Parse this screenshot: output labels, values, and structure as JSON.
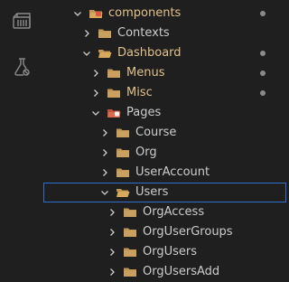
{
  "tree": [
    {
      "label": "components",
      "expanded": true,
      "modified": true,
      "folder": "special",
      "depth": 0
    },
    {
      "label": "Contexts",
      "expanded": false,
      "modified": false,
      "folder": "plain",
      "depth": 1
    },
    {
      "label": "Dashboard",
      "expanded": true,
      "modified": true,
      "folder": "plain",
      "depth": 1
    },
    {
      "label": "Menus",
      "expanded": false,
      "modified": true,
      "folder": "plain",
      "depth": 2
    },
    {
      "label": "Misc",
      "expanded": false,
      "modified": true,
      "folder": "plain",
      "depth": 2
    },
    {
      "label": "Pages",
      "expanded": true,
      "modified": false,
      "folder": "pages",
      "depth": 2
    },
    {
      "label": "Course",
      "expanded": false,
      "modified": false,
      "folder": "plain",
      "depth": 3
    },
    {
      "label": "Org",
      "expanded": false,
      "modified": false,
      "folder": "plain",
      "depth": 3
    },
    {
      "label": "UserAccount",
      "expanded": false,
      "modified": false,
      "folder": "plain",
      "depth": 3
    },
    {
      "label": "Users",
      "expanded": true,
      "modified": false,
      "folder": "plain",
      "depth": 3,
      "selected": true
    },
    {
      "label": "OrgAccess",
      "expanded": false,
      "modified": false,
      "folder": "plain",
      "depth": 4
    },
    {
      "label": "OrgUserGroups",
      "expanded": false,
      "modified": false,
      "folder": "plain",
      "depth": 4
    },
    {
      "label": "OrgUsers",
      "expanded": false,
      "modified": false,
      "folder": "plain",
      "depth": 4
    },
    {
      "label": "OrgUsersAdd",
      "expanded": false,
      "modified": false,
      "folder": "plain",
      "depth": 4
    }
  ],
  "activity_icons": [
    "remote-explorer-icon",
    "testing-flask-icon"
  ],
  "colors": {
    "background": "#1f1f1f",
    "modified_text": "#e2c08d",
    "text": "#cccccc",
    "folder": "#c09553",
    "selection_border": "#2f6fd0"
  }
}
